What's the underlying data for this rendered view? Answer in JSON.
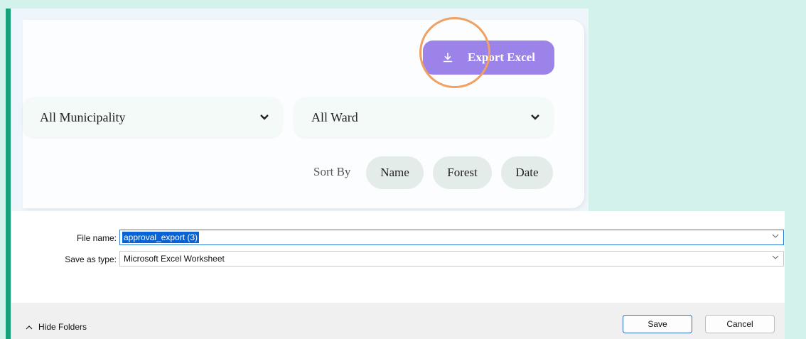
{
  "app": {
    "export_button": {
      "label": "Export Excel",
      "icon": "download-icon"
    },
    "filters": {
      "municipality": "All Municipality",
      "ward": "All Ward"
    },
    "sort": {
      "label": "Sort By",
      "options": [
        "Name",
        "Forest",
        "Date"
      ]
    }
  },
  "dialog": {
    "file_name_label": "File name:",
    "file_name_value": "approval_export (3)",
    "save_type_label": "Save as type:",
    "save_type_value": "Microsoft Excel Worksheet",
    "hide_folders_label": "Hide Folders",
    "save_label": "Save",
    "cancel_label": "Cancel"
  },
  "colors": {
    "accent_purple": "#9c83ea",
    "highlight_ring": "#f0a062",
    "side_bar_green": "#17a07a",
    "page_background": "#d4f2ec"
  }
}
